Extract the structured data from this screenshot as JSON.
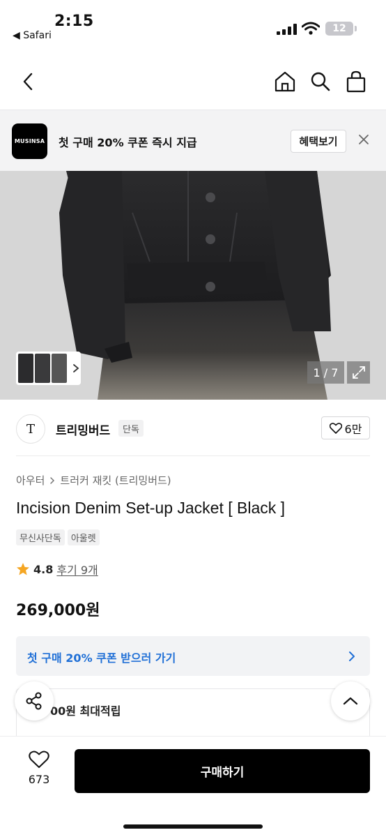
{
  "status_bar": {
    "time": "2:15",
    "back_app_label": "◀ Safari",
    "battery_level": "12"
  },
  "nav": {
    "back_icon": "chevron-left-icon",
    "home_icon": "home-icon",
    "search_icon": "search-icon",
    "cart_icon": "shopping-bag-icon"
  },
  "banner": {
    "logo_text": "MUSINSA",
    "message": "첫 구매 20% 쿠폰 즉시 지급",
    "button_label": "혜택보기",
    "close_icon": "close-icon"
  },
  "gallery": {
    "page_indicator": "1 / 7",
    "current_page": 1,
    "total_pages": 7,
    "fullscreen_icon": "expand-icon"
  },
  "brand": {
    "logo_mark": "T",
    "name": "트리밍버드",
    "badge": "단독",
    "likes_label": "6만"
  },
  "product": {
    "breadcrumb": [
      "아우터",
      "트러커 재킷 (트리밍버드)"
    ],
    "title": "Incision Denim Set-up Jacket [ Black ]",
    "tags": [
      "무신사단독",
      "아울렛"
    ],
    "rating": "4.8",
    "reviews_label": "후기 9개",
    "price": "269,000원"
  },
  "coupon": {
    "label": "첫 구매 20% 쿠폰 받으러 가기"
  },
  "points": {
    "label": "00원 최대적립"
  },
  "bottom_bar": {
    "wish_count": "673",
    "buy_label": "구매하기"
  },
  "colors": {
    "accent_blue": "#1f6fd6",
    "star": "#f5a623",
    "buy_button": "#000000"
  }
}
